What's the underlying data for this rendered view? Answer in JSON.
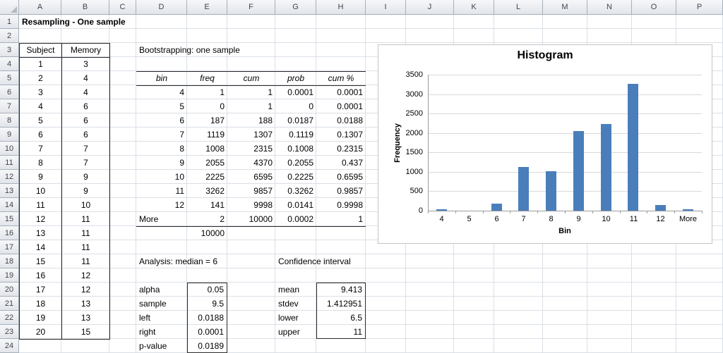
{
  "sheet": {
    "column_headers": [
      "A",
      "B",
      "C",
      "D",
      "E",
      "F",
      "G",
      "H",
      "I",
      "J",
      "K",
      "L",
      "M",
      "N",
      "O",
      "P"
    ],
    "row_count": 24,
    "title_cell": "Resampling - One sample"
  },
  "subject_table": {
    "headers": [
      "Subject",
      "Memory"
    ],
    "rows": [
      [
        1,
        3
      ],
      [
        2,
        4
      ],
      [
        3,
        4
      ],
      [
        4,
        6
      ],
      [
        5,
        6
      ],
      [
        6,
        6
      ],
      [
        7,
        7
      ],
      [
        8,
        7
      ],
      [
        9,
        9
      ],
      [
        10,
        9
      ],
      [
        11,
        10
      ],
      [
        12,
        11
      ],
      [
        13,
        11
      ],
      [
        14,
        11
      ],
      [
        15,
        11
      ],
      [
        16,
        12
      ],
      [
        17,
        12
      ],
      [
        18,
        13
      ],
      [
        19,
        13
      ],
      [
        20,
        15
      ]
    ]
  },
  "bootstrap_table": {
    "title": "Bootstrapping: one sample",
    "headers": [
      "bin",
      "freq",
      "cum",
      "prob",
      "cum %"
    ],
    "rows": [
      [
        "4",
        "1",
        "1",
        "0.0001",
        "0.0001"
      ],
      [
        "5",
        "0",
        "1",
        "0",
        "0.0001"
      ],
      [
        "6",
        "187",
        "188",
        "0.0187",
        "0.0188"
      ],
      [
        "7",
        "1119",
        "1307",
        "0.1119",
        "0.1307"
      ],
      [
        "8",
        "1008",
        "2315",
        "0.1008",
        "0.2315"
      ],
      [
        "9",
        "2055",
        "4370",
        "0.2055",
        "0.437"
      ],
      [
        "10",
        "2225",
        "6595",
        "0.2225",
        "0.6595"
      ],
      [
        "11",
        "3262",
        "9857",
        "0.3262",
        "0.9857"
      ],
      [
        "12",
        "141",
        "9998",
        "0.0141",
        "0.9998"
      ]
    ],
    "more_row": [
      "More",
      "2",
      "10000",
      "0.0002",
      "1"
    ],
    "total": "10000"
  },
  "analysis": {
    "title": "Analysis: median = 6",
    "rows": [
      [
        "alpha",
        "0.05"
      ],
      [
        "sample",
        "9.5"
      ],
      [
        "left",
        "0.0188"
      ],
      [
        "right",
        "0.0001"
      ],
      [
        "p-value",
        "0.0189"
      ]
    ]
  },
  "confidence": {
    "title": "Confidence interval",
    "rows": [
      [
        "mean",
        "9.413"
      ],
      [
        "stdev",
        "1.412951"
      ],
      [
        "lower",
        "6.5"
      ],
      [
        "upper",
        "11"
      ]
    ]
  },
  "chart_data": {
    "type": "bar",
    "title": "Histogram",
    "categories": [
      "4",
      "5",
      "6",
      "7",
      "8",
      "9",
      "10",
      "11",
      "12",
      "More"
    ],
    "values": [
      1,
      0,
      187,
      1119,
      1008,
      2055,
      2225,
      3262,
      141,
      2
    ],
    "xlabel": "Bin",
    "ylabel": "Frequency",
    "ylim": [
      0,
      3500
    ],
    "ytick_step": 500,
    "bar_color": "#4a7ebb",
    "grid": "horizontal",
    "legend": "none"
  }
}
